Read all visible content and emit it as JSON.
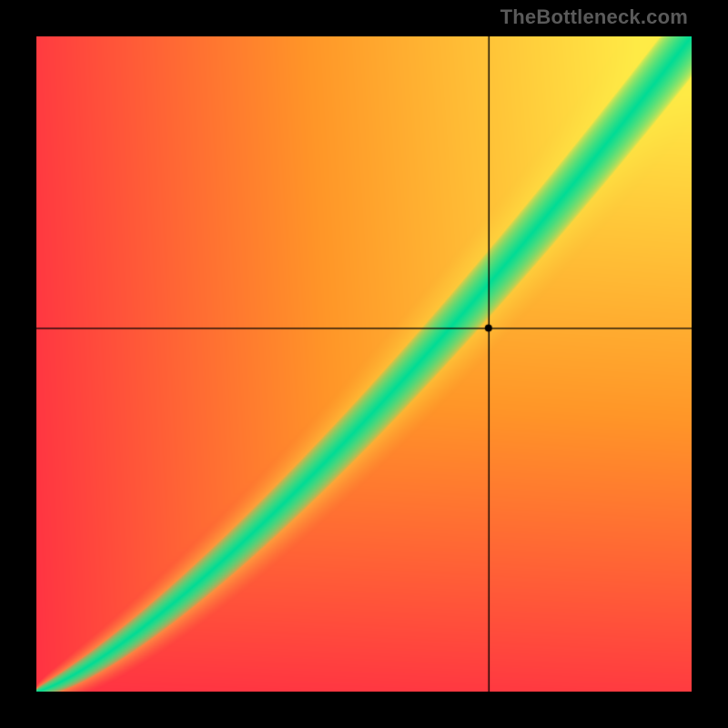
{
  "watermark": {
    "text": "TheBottleneck.com"
  },
  "chart_data": {
    "type": "heatmap",
    "title": "",
    "xlabel": "",
    "ylabel": "",
    "xlim": [
      0,
      1
    ],
    "ylim": [
      0,
      1
    ],
    "crosshair": {
      "x": 0.69,
      "y": 0.555
    },
    "marker": {
      "x": 0.69,
      "y": 0.555,
      "radius": 4
    },
    "band": {
      "description": "green optimal band following a superlinear curve from bottom-left to top-right",
      "center_curve_exponent": 1.28,
      "halfwidth_min": 0.003,
      "halfwidth_max": 0.062,
      "yellow_halo_mult": 2.1
    },
    "background_gradient": {
      "description": "diagonal red→orange→yellow from bottom-left outward, darkest red at corners far from band"
    },
    "series": []
  }
}
